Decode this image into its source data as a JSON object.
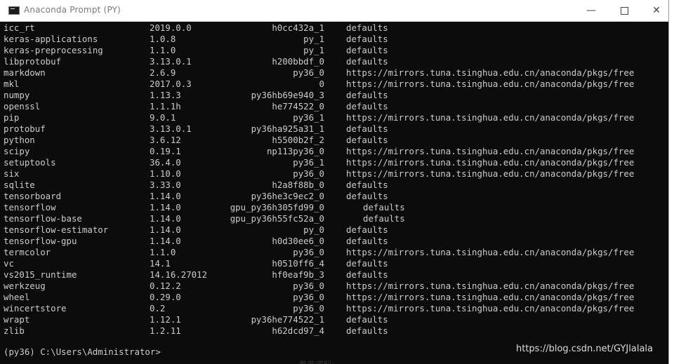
{
  "window": {
    "title": "Anaconda Prompt (PY)",
    "minimize": "—",
    "close": "✕"
  },
  "packages": [
    {
      "name": "icc_rt",
      "version": "2019.0.0",
      "build": "h0cc432a_1",
      "channel": "defaults"
    },
    {
      "name": "keras-applications",
      "version": "1.0.8",
      "build": "py_1",
      "channel": "defaults"
    },
    {
      "name": "keras-preprocessing",
      "version": "1.1.0",
      "build": "py_1",
      "channel": "defaults"
    },
    {
      "name": "libprotobuf",
      "version": "3.13.0.1",
      "build": "h200bbdf_0",
      "channel": "defaults"
    },
    {
      "name": "markdown",
      "version": "2.6.9",
      "build": "py36_0",
      "channel": "https://mirrors.tuna.tsinghua.edu.cn/anaconda/pkgs/free"
    },
    {
      "name": "mkl",
      "version": "2017.0.3",
      "build": "0",
      "channel": "https://mirrors.tuna.tsinghua.edu.cn/anaconda/pkgs/free"
    },
    {
      "name": "numpy",
      "version": "1.13.3",
      "build": "py36hb69e940_3",
      "channel": "defaults"
    },
    {
      "name": "openssl",
      "version": "1.1.1h",
      "build": "he774522_0",
      "channel": "defaults"
    },
    {
      "name": "pip",
      "version": "9.0.1",
      "build": "py36_1",
      "channel": "https://mirrors.tuna.tsinghua.edu.cn/anaconda/pkgs/free"
    },
    {
      "name": "protobuf",
      "version": "3.13.0.1",
      "build": "py36ha925a31_1",
      "channel": "defaults"
    },
    {
      "name": "python",
      "version": "3.6.12",
      "build": "h5500b2f_2",
      "channel": "defaults"
    },
    {
      "name": "scipy",
      "version": "0.19.1",
      "build": "np113py36_0",
      "channel": "https://mirrors.tuna.tsinghua.edu.cn/anaconda/pkgs/free"
    },
    {
      "name": "setuptools",
      "version": "36.4.0",
      "build": "py36_1",
      "channel": "https://mirrors.tuna.tsinghua.edu.cn/anaconda/pkgs/free"
    },
    {
      "name": "six",
      "version": "1.10.0",
      "build": "py36_0",
      "channel": "https://mirrors.tuna.tsinghua.edu.cn/anaconda/pkgs/free"
    },
    {
      "name": "sqlite",
      "version": "3.33.0",
      "build": "h2a8f88b_0",
      "channel": "defaults"
    },
    {
      "name": "tensorboard",
      "version": "1.14.0",
      "build": "py36he3c9ec2_0",
      "channel": "defaults"
    },
    {
      "name": "tensorflow",
      "version": "1.14.0",
      "build": "gpu_py36h305fd99_0",
      "channel": "defaults"
    },
    {
      "name": "tensorflow-base",
      "version": "1.14.0",
      "build": "gpu_py36h55fc52a_0",
      "channel": "defaults"
    },
    {
      "name": "tensorflow-estimator",
      "version": "1.14.0",
      "build": "py_0",
      "channel": "defaults"
    },
    {
      "name": "tensorflow-gpu",
      "version": "1.14.0",
      "build": "h0d30ee6_0",
      "channel": "defaults"
    },
    {
      "name": "termcolor",
      "version": "1.1.0",
      "build": "py36_0",
      "channel": "https://mirrors.tuna.tsinghua.edu.cn/anaconda/pkgs/free"
    },
    {
      "name": "vc",
      "version": "14.1",
      "build": "h0510ff6_4",
      "channel": "defaults"
    },
    {
      "name": "vs2015_runtime",
      "version": "14.16.27012",
      "build": "hf0eaf9b_3",
      "channel": "defaults"
    },
    {
      "name": "werkzeug",
      "version": "0.12.2",
      "build": "py36_0",
      "channel": "https://mirrors.tuna.tsinghua.edu.cn/anaconda/pkgs/free"
    },
    {
      "name": "wheel",
      "version": "0.29.0",
      "build": "py36_0",
      "channel": "https://mirrors.tuna.tsinghua.edu.cn/anaconda/pkgs/free"
    },
    {
      "name": "wincertstore",
      "version": "0.2",
      "build": "py36_0",
      "channel": "https://mirrors.tuna.tsinghua.edu.cn/anaconda/pkgs/free"
    },
    {
      "name": "wrapt",
      "version": "1.12.1",
      "build": "py36he774522_1",
      "channel": "defaults"
    },
    {
      "name": "zlib",
      "version": "1.2.11",
      "build": "h62dcd97_4",
      "channel": "defaults"
    }
  ],
  "prompt": "(py36) C:\\Users\\Administrator>",
  "watermark": "https://blog.csdn.net/GYJlalala",
  "behind_text": "参考资料:",
  "colors": {
    "console_bg": "#0c0c0c",
    "console_fg": "#cccccc",
    "titlebar_bg": "#ffffff"
  }
}
